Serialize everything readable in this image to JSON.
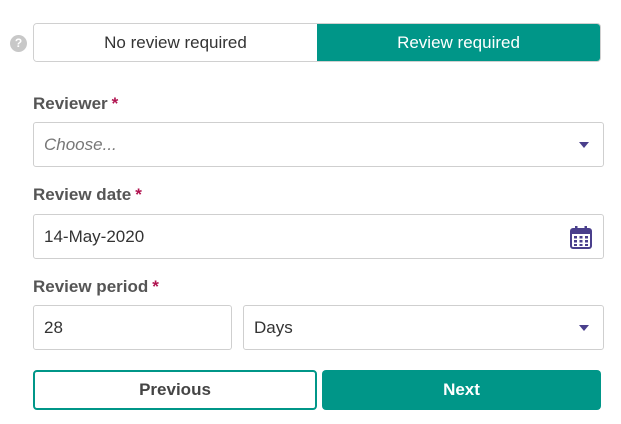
{
  "help_icon": "?",
  "toggle": {
    "no_review_label": "No review required",
    "review_label": "Review required",
    "selected": "Review required"
  },
  "reviewer": {
    "label": "Reviewer",
    "required_mark": "*",
    "placeholder": "Choose..."
  },
  "review_date": {
    "label": "Review date",
    "required_mark": "*",
    "value": "14-May-2020",
    "icon": "calendar-icon"
  },
  "review_period": {
    "label": "Review period",
    "required_mark": "*",
    "amount": "28",
    "unit": "Days"
  },
  "buttons": {
    "previous": "Previous",
    "next": "Next"
  },
  "colors": {
    "accent": "#009688",
    "required": "#b0124f",
    "caret": "#4a3f8c"
  }
}
